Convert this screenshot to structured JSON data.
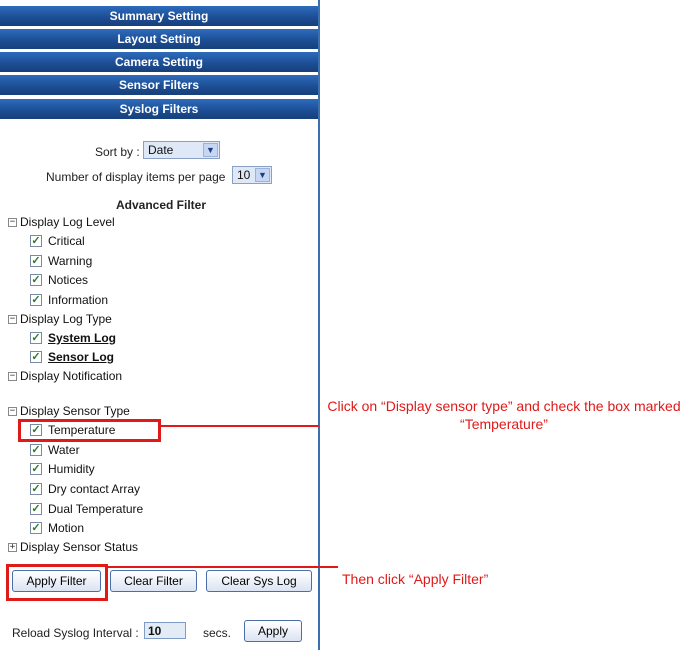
{
  "tabs": [
    "Summary Setting",
    "Layout Setting",
    "Camera Setting",
    "Sensor Filters",
    "Syslog Filters"
  ],
  "sort": {
    "label": "Sort by :",
    "value": "Date"
  },
  "per_page": {
    "label": "Number of display items per page",
    "value": "10"
  },
  "advanced_filter": "Advanced Filter",
  "log_level": {
    "title": "Display Log Level",
    "items": [
      "Critical",
      "Warning",
      "Notices",
      "Information"
    ]
  },
  "log_type": {
    "title": "Display Log Type",
    "items": [
      "System Log",
      "Sensor Log"
    ]
  },
  "notification": {
    "title": "Display Notification"
  },
  "sensor_type": {
    "title": "Display Sensor Type",
    "items": [
      "Temperature",
      "Water",
      "Humidity",
      "Dry contact Array",
      "Dual Temperature",
      "Motion"
    ]
  },
  "sensor_status": {
    "title": "Display Sensor Status"
  },
  "buttons": {
    "apply_filter": "Apply Filter",
    "clear_filter": "Clear Filter",
    "clear_sys_log": "Clear Sys Log",
    "apply": "Apply"
  },
  "reload": {
    "label": "Reload Syslog Interval :",
    "value": "10",
    "unit": "secs."
  },
  "callouts": {
    "sensor_type": "Click on “Display sensor type” and check the box marked “Temperature”",
    "apply_filter": "Then click “Apply Filter”"
  },
  "colors": {
    "tab_blue": "#1d4f95",
    "annotation_red": "#e01919"
  }
}
